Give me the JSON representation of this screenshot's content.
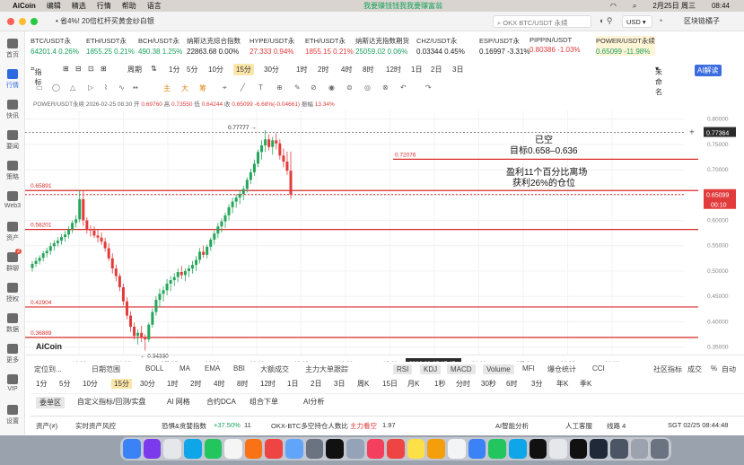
{
  "menubar": {
    "app": "AiCoin",
    "items": [
      "编辑",
      "精选",
      "行情",
      "帮助",
      "语言"
    ],
    "ticker": "我要赚钱钱我我要赚富翁",
    "ticker_tail": "我要赚钱",
    "date": "2月25日 周三",
    "time": "08:44"
  },
  "titlebar": {
    "promo": "• 省4%! 20倍杠杆买黄金纱白银",
    "search": "OKX BTC/USDT 永续",
    "currency": "USD",
    "wallet": "区块链橘子"
  },
  "sidebar": [
    {
      "label": "首页",
      "icon": "home-icon"
    },
    {
      "label": "行情",
      "icon": "chart-icon",
      "active": true
    },
    {
      "label": "快讯",
      "icon": "news-icon"
    },
    {
      "label": "要闻",
      "icon": "article-icon"
    },
    {
      "label": "策略",
      "icon": "strategy-icon"
    },
    {
      "label": "Web3",
      "icon": "web3-icon"
    },
    {
      "label": "资产",
      "icon": "wallet-icon"
    },
    {
      "label": "群聊",
      "icon": "chat-icon",
      "badge": "2"
    },
    {
      "label": "授权",
      "icon": "auth-icon"
    },
    {
      "label": "数据",
      "icon": "data-icon"
    },
    {
      "label": "更多",
      "icon": "more-icon"
    },
    {
      "label": "VIP",
      "icon": "vip-icon"
    },
    {
      "label": "设置",
      "icon": "settings-icon"
    }
  ],
  "tickers": [
    {
      "name": "BTC/USDT永",
      "price": "64201.4",
      "change": "0.26%",
      "dir": "up"
    },
    {
      "name": "ETH/USDT永",
      "price": "1855.25",
      "change": "0.21%",
      "dir": "up"
    },
    {
      "name": "BCH/USDT永",
      "price": "490.38",
      "change": "1.25%",
      "dir": "up"
    },
    {
      "name": "纳斯达克综合指数",
      "price": "22863.68",
      "change": "0.00%",
      "dir": "flat"
    },
    {
      "name": "HYPE/USDT永",
      "price": "27.333",
      "change": "0.94%",
      "dir": "dn"
    },
    {
      "name": "ETH/USDT永",
      "price": "1855.15",
      "change": "0.21%",
      "dir": "dn"
    },
    {
      "name": "纳斯达克指数期货",
      "price": "25059.02",
      "change": "0.06%",
      "dir": "up"
    },
    {
      "name": "CHZ/USDT永",
      "price": "0.03344",
      "change": "0.45%",
      "dir": "flat"
    },
    {
      "name": "ESP/USDT永",
      "price": "0.16997",
      "change": "-3.31%",
      "dir": "flat"
    },
    {
      "name": "PIPPIN/USDT",
      "price": "0.80386",
      "change": "-1.03%",
      "dir": "dn"
    },
    {
      "name": "POWER/USDT永续",
      "price": "0.65099",
      "change": "-11.98%",
      "dir": "up",
      "selected": true
    }
  ],
  "toolbar1": {
    "indicator": "指标",
    "period_label": "周期",
    "periods": [
      "1分",
      "5分",
      "10分",
      "15分",
      "30分",
      "1时",
      "2时",
      "4时",
      "8时",
      "12时",
      "1日",
      "2日",
      "3日"
    ],
    "active": "15分",
    "chart_type": "未命名",
    "ai": "AI解读"
  },
  "toolbar2": {
    "zhu": "主",
    "da": "大",
    "chou": "筹"
  },
  "chartinfo": {
    "symbol": "POWER/USDT永续",
    "date": "2026-02-25 08:30",
    "open_label": "开",
    "open": "0.69760",
    "high_label": "高",
    "high": "0.73550",
    "low_label": "低",
    "low": "0.64244",
    "close_label": "收",
    "close": "0.65099",
    "change": "-6.68%(-0.04661)",
    "amp_label": "振幅",
    "amp": "13.34%"
  },
  "chart_data": {
    "type": "candlestick",
    "symbol": "POWER/USDT永续",
    "interval": "15分",
    "current_price": "0.65099",
    "countdown": "00:10",
    "crosshair_price": "0.77364",
    "crosshair_time": "2026-02-25 17:45",
    "high_mark": "0.77777",
    "low_mark": "0.34330",
    "y_ticks": [
      "0.80000",
      "0.75000",
      "0.70000",
      "0.65000",
      "0.60000",
      "0.55000",
      "0.50000",
      "0.45000",
      "0.40000",
      "0.35000"
    ],
    "x_ticks": [
      "18:00",
      "21:00",
      "2月 25",
      "03:00",
      "06:00",
      "09:00",
      "12:00",
      "15:00",
      "18:00",
      "21:00",
      "2月 26",
      "03:00",
      "06:00"
    ],
    "levels": [
      {
        "price": 0.72076,
        "label": "0.72076"
      },
      {
        "price": 0.65891,
        "label": "0.65891"
      },
      {
        "price": 0.58201,
        "label": "0.58201"
      },
      {
        "price": 0.42904,
        "label": "0.42904"
      },
      {
        "price": 0.36889,
        "label": "0.36889"
      }
    ],
    "ohlc": [
      [
        0.506,
        0.519,
        0.499,
        0.514
      ],
      [
        0.514,
        0.527,
        0.508,
        0.52
      ],
      [
        0.52,
        0.531,
        0.513,
        0.526
      ],
      [
        0.526,
        0.54,
        0.519,
        0.535
      ],
      [
        0.535,
        0.546,
        0.527,
        0.54
      ],
      [
        0.54,
        0.556,
        0.532,
        0.549
      ],
      [
        0.549,
        0.561,
        0.54,
        0.555
      ],
      [
        0.555,
        0.567,
        0.548,
        0.56
      ],
      [
        0.56,
        0.573,
        0.552,
        0.567
      ],
      [
        0.567,
        0.579,
        0.558,
        0.572
      ],
      [
        0.572,
        0.588,
        0.564,
        0.582
      ],
      [
        0.582,
        0.6,
        0.575,
        0.595
      ],
      [
        0.595,
        0.61,
        0.586,
        0.602
      ],
      [
        0.602,
        0.659,
        0.596,
        0.642
      ],
      [
        0.642,
        0.659,
        0.589,
        0.6
      ],
      [
        0.6,
        0.606,
        0.574,
        0.583
      ],
      [
        0.583,
        0.59,
        0.568,
        0.58
      ],
      [
        0.58,
        0.588,
        0.565,
        0.57
      ],
      [
        0.57,
        0.582,
        0.556,
        0.566
      ],
      [
        0.566,
        0.576,
        0.552,
        0.558
      ],
      [
        0.558,
        0.566,
        0.538,
        0.545
      ],
      [
        0.545,
        0.555,
        0.52,
        0.525
      ],
      [
        0.525,
        0.535,
        0.495,
        0.505
      ],
      [
        0.505,
        0.513,
        0.48,
        0.49
      ],
      [
        0.49,
        0.495,
        0.46,
        0.468
      ],
      [
        0.468,
        0.475,
        0.432,
        0.44
      ],
      [
        0.44,
        0.448,
        0.405,
        0.412
      ],
      [
        0.412,
        0.42,
        0.38,
        0.39
      ],
      [
        0.39,
        0.398,
        0.365,
        0.372
      ],
      [
        0.372,
        0.385,
        0.355,
        0.378
      ],
      [
        0.378,
        0.392,
        0.36,
        0.368
      ],
      [
        0.368,
        0.375,
        0.343,
        0.365
      ],
      [
        0.365,
        0.398,
        0.36,
        0.394
      ],
      [
        0.394,
        0.426,
        0.388,
        0.419
      ],
      [
        0.419,
        0.45,
        0.412,
        0.443
      ],
      [
        0.443,
        0.465,
        0.428,
        0.455
      ],
      [
        0.455,
        0.47,
        0.44,
        0.462
      ],
      [
        0.462,
        0.484,
        0.452,
        0.475
      ],
      [
        0.475,
        0.49,
        0.46,
        0.482
      ],
      [
        0.482,
        0.496,
        0.47,
        0.488
      ],
      [
        0.488,
        0.505,
        0.478,
        0.498
      ],
      [
        0.498,
        0.51,
        0.484,
        0.492
      ],
      [
        0.492,
        0.505,
        0.48,
        0.5
      ],
      [
        0.5,
        0.512,
        0.488,
        0.505
      ],
      [
        0.505,
        0.52,
        0.495,
        0.512
      ],
      [
        0.512,
        0.53,
        0.5,
        0.522
      ],
      [
        0.522,
        0.545,
        0.515,
        0.538
      ],
      [
        0.538,
        0.55,
        0.526,
        0.532
      ],
      [
        0.532,
        0.552,
        0.525,
        0.548
      ],
      [
        0.548,
        0.566,
        0.54,
        0.562
      ],
      [
        0.562,
        0.58,
        0.552,
        0.574
      ],
      [
        0.574,
        0.595,
        0.565,
        0.588
      ],
      [
        0.588,
        0.604,
        0.576,
        0.598
      ],
      [
        0.598,
        0.615,
        0.585,
        0.61
      ],
      [
        0.61,
        0.632,
        0.6,
        0.626
      ],
      [
        0.626,
        0.645,
        0.614,
        0.637
      ],
      [
        0.637,
        0.652,
        0.625,
        0.645
      ],
      [
        0.645,
        0.66,
        0.632,
        0.652
      ],
      [
        0.652,
        0.668,
        0.64,
        0.662
      ],
      [
        0.662,
        0.685,
        0.655,
        0.68
      ],
      [
        0.68,
        0.702,
        0.672,
        0.695
      ],
      [
        0.695,
        0.72,
        0.688,
        0.712
      ],
      [
        0.712,
        0.74,
        0.705,
        0.735
      ],
      [
        0.735,
        0.758,
        0.72,
        0.748
      ],
      [
        0.748,
        0.778,
        0.735,
        0.76
      ],
      [
        0.76,
        0.77,
        0.738,
        0.745
      ],
      [
        0.745,
        0.765,
        0.73,
        0.758
      ],
      [
        0.758,
        0.772,
        0.74,
        0.752
      ],
      [
        0.752,
        0.76,
        0.72,
        0.728
      ],
      [
        0.728,
        0.742,
        0.705,
        0.716
      ],
      [
        0.716,
        0.736,
        0.69,
        0.698
      ],
      [
        0.698,
        0.736,
        0.642,
        0.651
      ]
    ],
    "annotations": {
      "position": "已空",
      "target": "目标0.658–0.636",
      "profit1": "盈利11个百分比离场",
      "profit2": "获利26%的仓位"
    },
    "logo": "AiCoin"
  },
  "bottom1": {
    "items": [
      "定位到...",
      "日期范围",
      "BOLL",
      "MA",
      "EMA",
      "BBI",
      "大额成交",
      "主力大单跟踪",
      "RSI",
      "KDJ",
      "MACD",
      "Volume",
      "MFI",
      "爆仓统计",
      "CCI",
      "社区指标",
      "成交",
      "%",
      "自动"
    ]
  },
  "bottom2": {
    "items": [
      "1分",
      "5分",
      "10分",
      "15分",
      "30分",
      "1时",
      "2时",
      "4时",
      "8时",
      "12时",
      "1日",
      "2日",
      "3日",
      "周K",
      "15日",
      "月K",
      "1秒",
      "分时",
      "30秒",
      "6时",
      "3分",
      "年K",
      "季K"
    ],
    "active": "15分"
  },
  "bottom3": {
    "items": [
      "委单区",
      "自定义指标/回测/实盘",
      "AI 网格",
      "合约DCA",
      "组合下单",
      "AI分析"
    ]
  },
  "status": {
    "asset": "资产(≠)",
    "risk": "实时资产风控",
    "fear": "恐惧&贪婪指数",
    "fear_change": "+37.50%",
    "fear_val": "11",
    "ls": "OKX-BTC多空持仓人数比",
    "main": "主力看空",
    "main_val": "1.97",
    "ai_analysis": "AI智能分析",
    "service": "人工客服",
    "line": "线路 4",
    "sgt": "SGT 02/25 08:44:48"
  }
}
